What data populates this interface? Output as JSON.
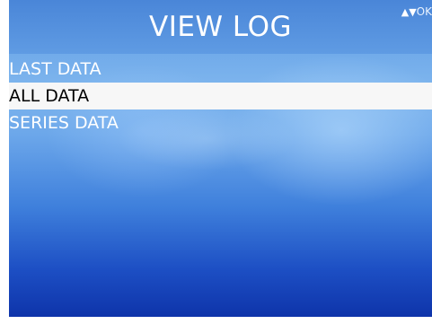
{
  "header": {
    "title": "VIEW LOG",
    "nav_hint": {
      "up_icon": "▲",
      "down_icon": "▼",
      "ok_label": "OK"
    }
  },
  "menu": {
    "items": [
      {
        "label": "LAST DATA",
        "selected": false
      },
      {
        "label": "ALL DATA",
        "selected": true
      },
      {
        "label": "SERIES DATA",
        "selected": false
      }
    ]
  },
  "colors": {
    "header_bg": "#5590dc",
    "selected_bg": "#f7f7f7",
    "selected_text": "#000000",
    "text": "#ffffff",
    "background_bottom": "#0e34aa"
  }
}
